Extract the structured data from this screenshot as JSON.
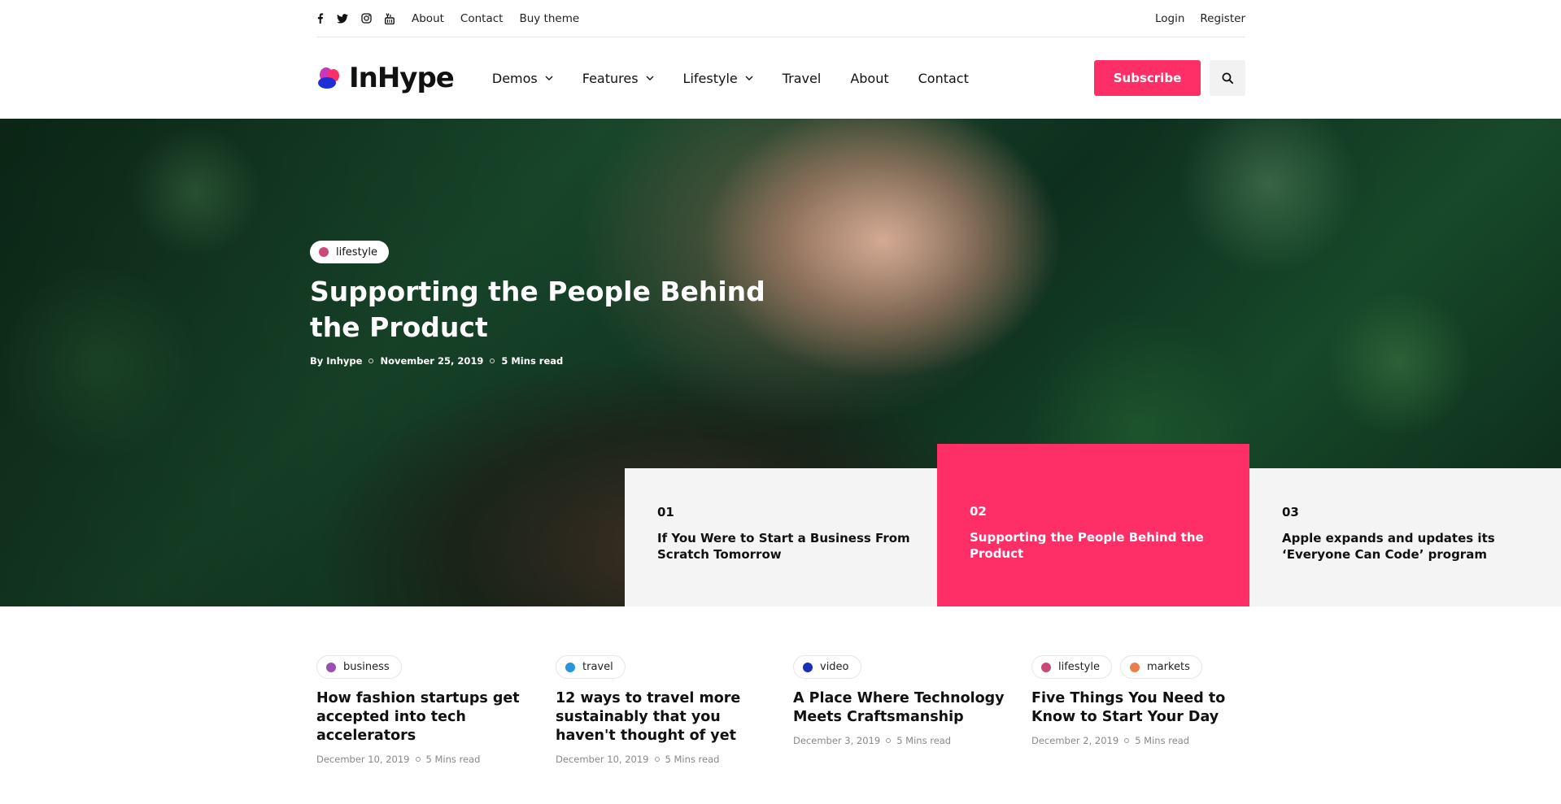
{
  "topbar": {
    "social": [
      "facebook-icon",
      "twitter-icon",
      "instagram-icon",
      "youtube-icon"
    ],
    "links": [
      "About",
      "Contact",
      "Buy theme"
    ],
    "login": "Login",
    "register": "Register"
  },
  "header": {
    "logo_text": "InHype",
    "nav": [
      {
        "label": "Demos",
        "dropdown": true
      },
      {
        "label": "Features",
        "dropdown": true
      },
      {
        "label": "Lifestyle",
        "dropdown": true
      },
      {
        "label": "Travel",
        "dropdown": false
      },
      {
        "label": "About",
        "dropdown": false
      },
      {
        "label": "Contact",
        "dropdown": false
      }
    ],
    "subscribe": "Subscribe"
  },
  "hero": {
    "category": "lifestyle",
    "category_color": "#c94a7a",
    "title": "Supporting the People Behind the Product",
    "author": "By Inhype",
    "date": "November 25, 2019",
    "read_time": "5 Mins read"
  },
  "tabs": [
    {
      "num": "01",
      "title": "If You Were to Start a Business From Scratch Tomorrow",
      "active": false
    },
    {
      "num": "02",
      "title": "Supporting the People Behind the Product",
      "active": true
    },
    {
      "num": "03",
      "title": "Apple expands and updates its ‘Everyone Can Code’ program",
      "active": false
    }
  ],
  "posts": [
    {
      "cats": [
        {
          "label": "business",
          "color": "#9b4fb3"
        }
      ],
      "title": "How fashion startups get accepted into tech accelerators",
      "date": "December 10, 2019",
      "read_time": "5 Mins read"
    },
    {
      "cats": [
        {
          "label": "travel",
          "color": "#2a96d8"
        }
      ],
      "title": "12 ways to travel more sustainably that you haven't thought of yet",
      "date": "December 10, 2019",
      "read_time": "5 Mins read"
    },
    {
      "cats": [
        {
          "label": "video",
          "color": "#1a2fb8"
        }
      ],
      "title": "A Place Where Technology Meets Craftsmanship",
      "date": "December 3, 2019",
      "read_time": "5 Mins read"
    },
    {
      "cats": [
        {
          "label": "lifestyle",
          "color": "#c94a7a"
        },
        {
          "label": "markets",
          "color": "#e8804a"
        }
      ],
      "title": "Five Things You Need to Know to Start Your Day",
      "date": "December 2, 2019",
      "read_time": "5 Mins read"
    }
  ],
  "colors": {
    "accent": "#fe2f66"
  }
}
